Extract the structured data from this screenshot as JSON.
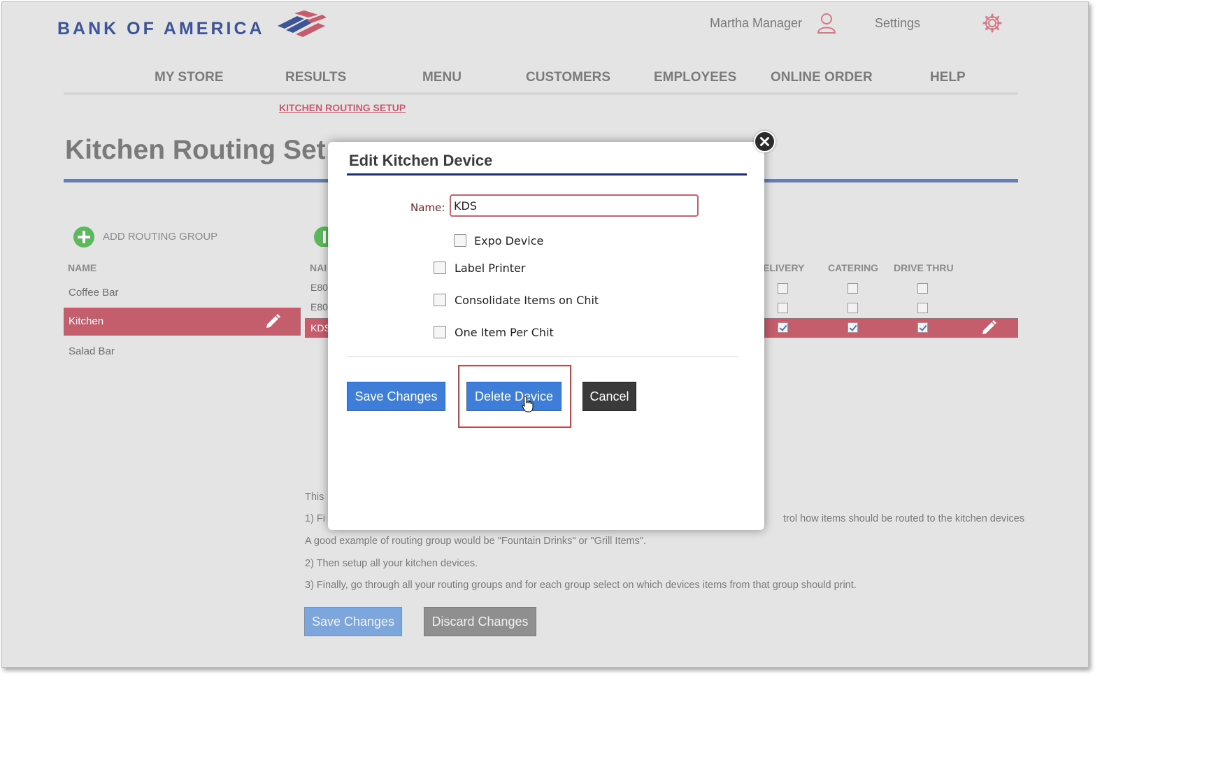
{
  "brand": {
    "name": "BANK OF AMERICA"
  },
  "header": {
    "user_name": "Martha Manager",
    "settings_label": "Settings"
  },
  "nav": {
    "items": [
      "MY STORE",
      "RESULTS",
      "MENU",
      "CUSTOMERS",
      "EMPLOYEES",
      "ONLINE ORDER",
      "HELP"
    ]
  },
  "subnav": {
    "active": "KITCHEN ROUTING SETUP"
  },
  "page": {
    "title": "Kitchen Routing Set"
  },
  "routing_groups": {
    "add_label": "ADD ROUTING GROUP",
    "column_header": "NAME",
    "items": [
      "Coffee Bar",
      "Kitchen",
      "Salad Bar"
    ],
    "selected": "Kitchen"
  },
  "devices": {
    "column_name": "NAI",
    "columns": [
      "ELIVERY",
      "CATERING",
      "DRIVE THRU"
    ],
    "rows": [
      {
        "name": "E80",
        "checks": [
          false,
          false,
          false
        ]
      },
      {
        "name": "E80",
        "checks": [
          false,
          false,
          false
        ]
      },
      {
        "name": "KDS",
        "checks": [
          true,
          true,
          true
        ]
      }
    ]
  },
  "instructions": {
    "line0": "This",
    "line1a": "1) Fi",
    "line1b": "trol how items should be routed to the kitchen devices",
    "line2": "A good example of routing group would be \"Fountain Drinks\" or \"Grill Items\".",
    "line3": "2) Then setup all your kitchen devices.",
    "line4": "3) Finally, go through all your routing groups and for each group select on which devices items from that group should print."
  },
  "footer_buttons": {
    "save": "Save Changes",
    "discard": "Discard Changes"
  },
  "modal": {
    "title": "Edit Kitchen Device",
    "name_label": "Name:",
    "name_value": "KDS",
    "options": [
      {
        "label": "Expo Device",
        "checked": false
      },
      {
        "label": "Label Printer",
        "checked": false
      },
      {
        "label": "Consolidate Items on Chit",
        "checked": false
      },
      {
        "label": "One Item Per Chit",
        "checked": false
      }
    ],
    "save_label": "Save Changes",
    "delete_label": "Delete Device",
    "cancel_label": "Cancel"
  },
  "colors": {
    "accent": "#c45e6d",
    "brand_blue": "#3d5596",
    "primary_button": "#3e7ed8"
  }
}
